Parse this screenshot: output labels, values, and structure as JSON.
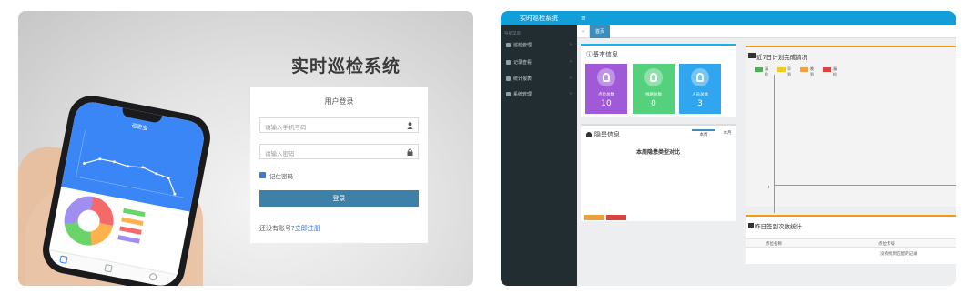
{
  "login": {
    "system_title": "实时巡检系统",
    "card_title": "用户登录",
    "phone_placeholder": "请输入手机号码",
    "password_placeholder": "请输入密码",
    "remember_label": "记住密码",
    "login_button": "登录",
    "register_prefix": "还没有账号?",
    "register_link": "立即注册",
    "phone_app_title": "巡更宝"
  },
  "dashboard": {
    "app_name": "实时巡检系统",
    "menu_toggle": "≡",
    "sidebar_caption": "导航菜单",
    "sidebar_items": [
      {
        "label": "巡检管理",
        "arrow": "›"
      },
      {
        "label": "记录查看",
        "arrow": "›"
      },
      {
        "label": "统计报表",
        "arrow": "›"
      },
      {
        "label": "系统管理",
        "arrow": "›"
      }
    ],
    "tab_prev": "«",
    "tab_home": "首页",
    "basic_info": {
      "title": "基本信息",
      "stats": [
        {
          "label": "点位总数",
          "value": "10",
          "color": "#a05ad8"
        },
        {
          "label": "线路总数",
          "value": "0",
          "color": "#55d07c"
        },
        {
          "label": "人员总数",
          "value": "3",
          "color": "#2fa6ee"
        }
      ]
    },
    "hazard": {
      "title": "隐患信息",
      "tab_week": "本周",
      "tab_month": "本月",
      "chart_title": "本周隐患类型对比",
      "legend_colors": [
        "#e8a13c",
        "#d9453e"
      ]
    },
    "plan": {
      "title": "近7日计划完成情况",
      "legend": [
        {
          "label": "漏检",
          "color": "#4fb04f"
        },
        {
          "label": "早到",
          "color": "#f2ca1f"
        },
        {
          "label": "晚到",
          "color": "#f5a03b"
        },
        {
          "label": "漏检",
          "color": "#d9453e"
        }
      ]
    },
    "signin": {
      "title": "昨日签到次数统计",
      "col1": "点位名称",
      "col2": "点位卡号",
      "empty": "没有找到匹配的记录"
    }
  }
}
